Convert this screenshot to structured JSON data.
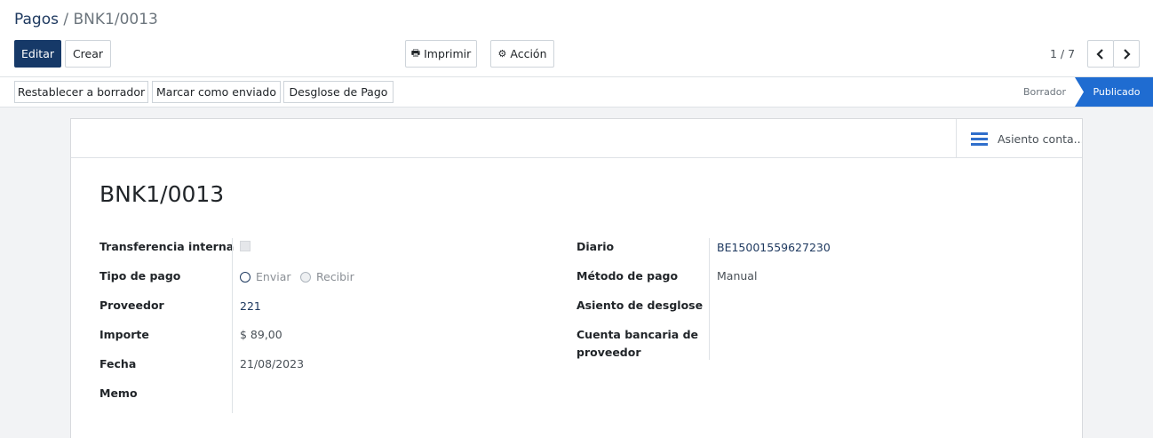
{
  "breadcrumb": {
    "parent": "Pagos",
    "separator": "/",
    "current": "BNK1/0013"
  },
  "toolbar": {
    "edit_label": "Editar",
    "create_label": "Crear",
    "print_label": "Imprimir",
    "action_label": "Acción"
  },
  "pager": {
    "value": "1 / 7"
  },
  "statusbar": {
    "buttons": [
      "Restablecer a borrador",
      "Marcar como enviado",
      "Desglose de Pago"
    ],
    "stages": [
      "Borrador",
      "Publicado"
    ],
    "active_stage": "Publicado"
  },
  "smart_button": {
    "label": "Asiento conta..."
  },
  "record": {
    "title": "BNK1/0013",
    "left": {
      "internal_transfer_label": "Transferencia interna",
      "payment_type_label": "Tipo de pago",
      "payment_type_options": [
        "Enviar",
        "Recibir"
      ],
      "payment_type_selected": "Enviar",
      "partner_label": "Proveedor",
      "partner_value": "221",
      "amount_label": "Importe",
      "amount_value": "$ 89,00",
      "date_label": "Fecha",
      "date_value": "21/08/2023",
      "memo_label": "Memo"
    },
    "right": {
      "journal_label": "Diario",
      "journal_value": "BE15001559627230",
      "method_label": "Método de pago",
      "method_value": "Manual",
      "breakdown_label": "Asiento de desglose",
      "bank_label_line1": "Cuenta bancaria de",
      "bank_label_line2": "proveedor"
    }
  },
  "colors": {
    "primary": "#163968",
    "active_stage": "#1f6cd1",
    "link": "#1f3a60"
  }
}
